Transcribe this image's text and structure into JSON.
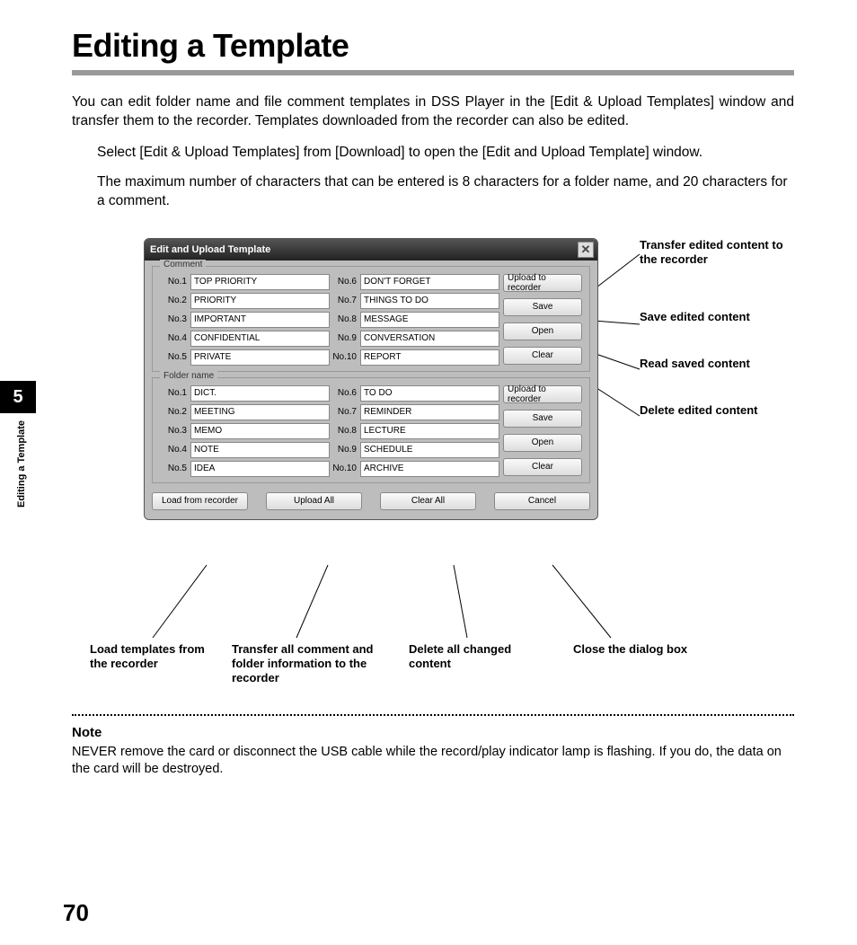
{
  "title": "Editing a Template",
  "intro": "You can edit folder name and file comment templates in DSS Player in the [Edit & Upload Templates] window and transfer them to the recorder. Templates downloaded from the recorder can also be edited.",
  "step1": "Select [Edit & Upload Templates] from [Download] to open the [Edit and Upload Template] window.",
  "step2": "The maximum number of characters that can be entered is 8 characters for a folder name, and 20 characters for a comment.",
  "chapter_num": "5",
  "side_label": "Editing a Template",
  "dialog_title": "Edit and Upload Template",
  "comment_group": "Comment",
  "folder_group": "Folder name",
  "labels_left": [
    "No.1",
    "No.2",
    "No.3",
    "No.4",
    "No.5"
  ],
  "labels_right": [
    "No.6",
    "No.7",
    "No.8",
    "No.9",
    "No.10"
  ],
  "comment_vals_left": [
    "TOP PRIORITY",
    "PRIORITY",
    "IMPORTANT",
    "CONFIDENTIAL",
    "PRIVATE"
  ],
  "comment_vals_right": [
    "DON'T FORGET",
    "THINGS TO DO",
    "MESSAGE",
    "CONVERSATION",
    "REPORT"
  ],
  "folder_vals_left": [
    "DICT.",
    "MEETING",
    "MEMO",
    "NOTE",
    "IDEA"
  ],
  "folder_vals_right": [
    "TO DO",
    "REMINDER",
    "LECTURE",
    "SCHEDULE",
    "ARCHIVE"
  ],
  "btn_upload": "Upload to recorder",
  "btn_save": "Save",
  "btn_open": "Open",
  "btn_clear": "Clear",
  "btn_load": "Load from recorder",
  "btn_upload_all": "Upload All",
  "btn_clear_all": "Clear All",
  "btn_cancel": "Cancel",
  "callouts_right": [
    "Transfer edited content to the recorder",
    "Save edited content",
    "Read saved content",
    "Delete edited content"
  ],
  "callouts_bottom": [
    "Load templates from the recorder",
    "Transfer all comment and folder information to the recorder",
    "Delete all changed content",
    "Close the dialog box"
  ],
  "note_heading": "Note",
  "note_text": "NEVER remove the card or disconnect the USB cable while the record/play indicator lamp is flashing. If you do, the data on the card will be destroyed.",
  "page_number": "70"
}
